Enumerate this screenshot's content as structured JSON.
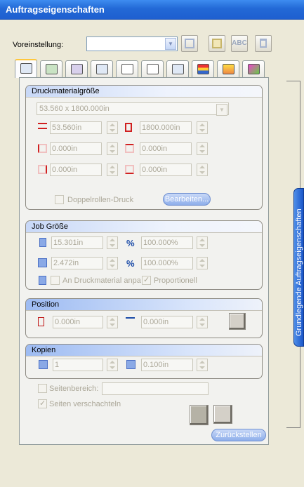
{
  "window": {
    "title": "Auftragseigenschaften"
  },
  "preset": {
    "label": "Voreinstellung:",
    "value": ""
  },
  "toolbar": {
    "save_icon": "floppy-disk-icon",
    "save_as_icon": "floppy-disk-yellow-icon",
    "rename_label": "ABC",
    "delete_icon": "trash-icon"
  },
  "tabs": [
    "print-settings-icon",
    "color-icon",
    "quality-icon",
    "media-icon",
    "cut-icon",
    "tiling-icon",
    "marks-icon",
    "layers-icon",
    "stack-icon",
    "pen-icon"
  ],
  "side_tab": {
    "label": "Grundlegende Auftragseigenschaften"
  },
  "media_size": {
    "title": "Druckmaterialgröße",
    "size_option": "53.560 x 1800.000in",
    "width": "53.560in",
    "height": "1800.000in",
    "margin_left": "0.000in",
    "margin_top": "0.000in",
    "margin_right": "0.000in",
    "margin_bottom": "0.000in",
    "double_roll_label": "Doppelrollen-Druck",
    "edit_button": "Bearbeiten..."
  },
  "job_size": {
    "title": "Job Größe",
    "width": "15.301in",
    "width_percent": "100.000%",
    "height": "2.472in",
    "height_percent": "100.000%",
    "percent_symbol": "%",
    "fit_media_label": "An Druckmaterial anpa",
    "proportional_label": "Proportionell"
  },
  "position": {
    "title": "Position",
    "x": "0.000in",
    "y": "0.000in"
  },
  "copies": {
    "title": "Kopien",
    "count": "1",
    "spacing": "0.100in"
  },
  "options": {
    "page_range_label": "Seitenbereich:",
    "page_range_value": "",
    "nest_pages_label": "Seiten verschachteln",
    "reset_button": "Zurückstellen"
  },
  "colors": {
    "title_bar": "#2369d6",
    "accent_yellow": "#ffc73c",
    "disabled_text": "#aca899"
  }
}
